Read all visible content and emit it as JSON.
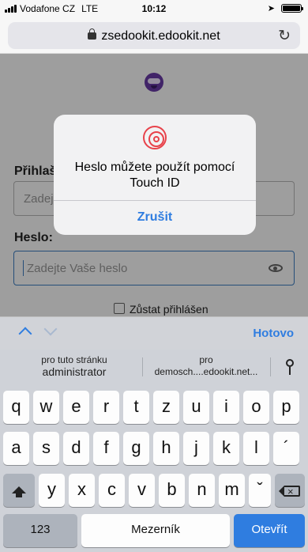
{
  "status": {
    "carrier": "Vodafone CZ",
    "network": "LTE",
    "time": "10:12",
    "battery_level": 1.0
  },
  "browser": {
    "url": "zsedookit.edookit.net",
    "reload_icon": "reload-icon",
    "lock_icon": "lock-icon"
  },
  "login": {
    "username_label": "Přihlaš",
    "username_placeholder": "Zadej",
    "password_label": "Heslo:",
    "password_placeholder": "Zadejte Vaše heslo",
    "remember_label": "Zůstat přihlášen"
  },
  "alert": {
    "icon": "fingerprint-icon",
    "message": "Heslo můžete použít pomocí Touch ID",
    "cancel_label": "Zrušit"
  },
  "accessory": {
    "done_label": "Hotovo"
  },
  "suggestions": [
    {
      "line1": "pro tuto stránku",
      "line2": "administrator"
    },
    {
      "line1": "pro",
      "line2": "demosch....edookit.net..."
    }
  ],
  "keyboard": {
    "row1": [
      "q",
      "w",
      "e",
      "r",
      "t",
      "z",
      "u",
      "i",
      "o",
      "p"
    ],
    "row2": [
      "a",
      "s",
      "d",
      "f",
      "g",
      "h",
      "j",
      "k",
      "l",
      "´"
    ],
    "row3": [
      "y",
      "x",
      "c",
      "v",
      "b",
      "n",
      "m",
      "ˇ"
    ],
    "numbers_label": "123",
    "space_label": "Mezerník",
    "go_label": "Otevřít"
  },
  "colors": {
    "accent": "#2f7de0",
    "fingerprint": "#e8424a"
  }
}
